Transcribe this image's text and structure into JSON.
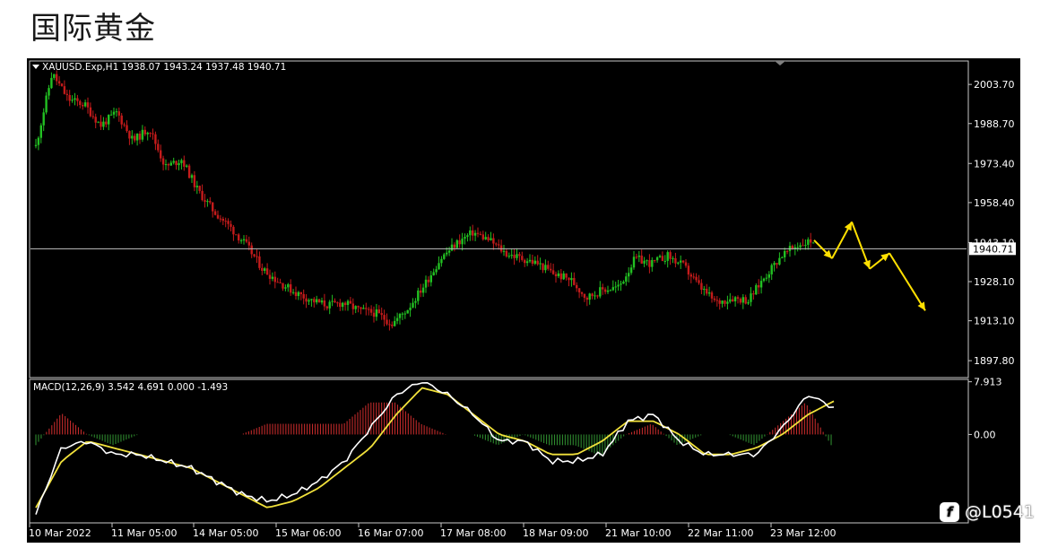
{
  "page_title": "国际黄金",
  "watermark": {
    "icon": "weibo-icon",
    "text": "@L0541"
  },
  "chart_data": [
    {
      "type": "candlestick",
      "symbol_header": "XAUUSD.Exp,H1  1938.07 1943.24 1937.48 1940.71",
      "ohlc_last": {
        "open": 1938.07,
        "high": 1943.24,
        "low": 1937.48,
        "close": 1940.71
      },
      "current_price_label": "1940.71",
      "y_ticks": [
        "2003.70",
        "1988.70",
        "1973.40",
        "1958.40",
        "1943.10",
        "1928.10",
        "1913.10",
        "1897.80"
      ],
      "ylim": [
        1892,
        2012
      ],
      "x_ticks": [
        "10 Mar 2022",
        "11 Mar 05:00",
        "14 Mar 05:00",
        "15 Mar 06:00",
        "16 Mar 07:00",
        "17 Mar 08:00",
        "18 Mar 09:00",
        "21 Mar 10:00",
        "22 Mar 11:00",
        "23 Mar 12:00"
      ],
      "price_path": [
        1980,
        2008,
        1998,
        1996,
        1988,
        1993,
        1982,
        1987,
        1972,
        1975,
        1963,
        1955,
        1949,
        1942,
        1933,
        1928,
        1924,
        1921,
        1919,
        1920,
        1917,
        1916,
        1912,
        1918,
        1927,
        1937,
        1943,
        1947,
        1944,
        1939,
        1937,
        1935,
        1931,
        1929,
        1922,
        1925,
        1926,
        1937,
        1935,
        1938,
        1934,
        1926,
        1920,
        1922,
        1921,
        1930,
        1938,
        1942,
        1944
      ],
      "forecast_path": [
        1944,
        1937,
        1951,
        1933,
        1939,
        1917
      ],
      "colors": {
        "up": "#22c022",
        "down": "#c41b1b",
        "forecast": "#ffe000",
        "background": "#000000"
      },
      "grid": false
    },
    {
      "type": "macd",
      "label": "MACD(12,26,9) 3.542 4.691 0.000 -1.493",
      "y_ticks": [
        "7.913",
        "0.00"
      ],
      "ylim": [
        -13,
        8
      ],
      "macd_line": [
        -12,
        -2,
        -1,
        -3,
        -3,
        -4,
        -5,
        -7,
        -9,
        -10,
        -9,
        -7,
        -4,
        1,
        6,
        8,
        6,
        3,
        -1,
        -1,
        -4,
        -4,
        -3,
        2,
        3,
        -1,
        -3,
        -3,
        -3,
        1,
        6,
        4
      ],
      "signal_line": [
        -11,
        -4,
        -1,
        -2,
        -3,
        -4,
        -5,
        -7,
        -9,
        -11,
        -10,
        -8,
        -5,
        -2,
        3,
        7,
        6,
        3,
        0,
        -1,
        -3,
        -3,
        -1,
        2,
        2,
        0,
        -3,
        -3,
        -2,
        0,
        3,
        5
      ],
      "colors": {
        "macd": "#ffffff",
        "signal": "#f1e13b",
        "hist_pos": "#c02a2a",
        "hist_neg": "#2f8a2f"
      }
    }
  ]
}
